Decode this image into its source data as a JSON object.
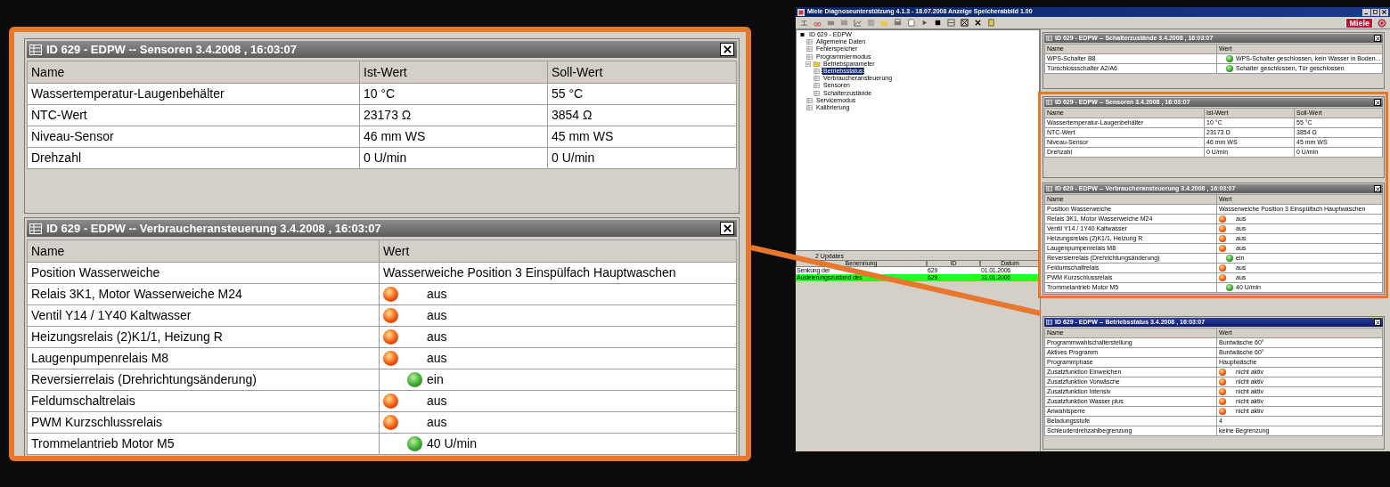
{
  "inset": {
    "panels": [
      {
        "title": "ID 629 - EDPW -- Sensoren 3.4.2008 , 16:03:07",
        "active": false,
        "columns": [
          "Name",
          "Ist-Wert",
          "Soll-Wert"
        ],
        "rows": [
          {
            "kind": "text",
            "cells": [
              "Wassertemperatur-Laugenbehälter",
              "10 °C",
              "55 °C"
            ]
          },
          {
            "kind": "text",
            "cells": [
              "NTC-Wert",
              "23173 Ω",
              "3854 Ω"
            ]
          },
          {
            "kind": "text",
            "cells": [
              "Niveau-Sensor",
              "46 mm WS",
              "45 mm WS"
            ]
          },
          {
            "kind": "text",
            "cells": [
              "Drehzahl",
              "0 U/min",
              "0 U/min"
            ]
          }
        ]
      },
      {
        "title": "ID 629 - EDPW -- Verbraucheransteuerung 3.4.2008 , 16:03:07",
        "active": false,
        "columns": [
          "Name",
          "Wert"
        ],
        "rows": [
          {
            "kind": "text",
            "cells": [
              "Position Wasserweiche",
              "Wasserweiche Position 3 Einspülfach Hauptwaschen"
            ]
          },
          {
            "kind": "lamp",
            "on": false,
            "cells": [
              "Relais 3K1, Motor Wasserweiche M24",
              "aus"
            ]
          },
          {
            "kind": "lamp",
            "on": false,
            "cells": [
              "Ventil Y14 / 1Y40 Kaltwasser",
              "aus"
            ]
          },
          {
            "kind": "lamp",
            "on": false,
            "cells": [
              "Heizungsrelais (2)K1/1, Heizung R",
              "aus"
            ]
          },
          {
            "kind": "lamp",
            "on": false,
            "cells": [
              "Laugenpumpenrelais M8",
              "aus"
            ]
          },
          {
            "kind": "lamp",
            "on": true,
            "cells": [
              "Reversierrelais (Drehrichtungsänderung)",
              "ein"
            ]
          },
          {
            "kind": "lamp",
            "on": false,
            "cells": [
              "Feldumschaltrelais",
              "aus"
            ]
          },
          {
            "kind": "lamp",
            "on": false,
            "cells": [
              "PWM Kurzschlussrelais",
              "aus"
            ]
          },
          {
            "kind": "lamp",
            "on": true,
            "cells": [
              "Trommelantrieb Motor M5",
              "40 U/min"
            ]
          }
        ]
      }
    ]
  },
  "window": {
    "title": "Miele Diagnoseunterstützung 4.1.3 - 18.07.2008 Anzeige Speicherabbild 1.00",
    "logo": "Miele"
  },
  "tree": {
    "label": "ID 629 - EDPW",
    "selected": false,
    "children": [
      {
        "label": "Allgemeine Daten",
        "selected": false
      },
      {
        "label": "Fehlerspeicher",
        "selected": false
      },
      {
        "label": "Programmiermodus",
        "selected": false
      },
      {
        "label": "Betriebsparameter",
        "selected": false,
        "expanded": true,
        "children": [
          {
            "label": "Betriebsstatus",
            "selected": true
          },
          {
            "label": "Verbraucheransteuerung",
            "selected": false
          },
          {
            "label": "Sensoren",
            "selected": false
          },
          {
            "label": "Schalterzustände",
            "selected": false
          }
        ]
      },
      {
        "label": "Servicemodus",
        "selected": false
      },
      {
        "label": "Kalibrierung",
        "selected": false
      }
    ]
  },
  "updates": {
    "caption": "2 Updates",
    "columns": [
      "Benennung",
      "ID",
      "Datum"
    ],
    "rows": [
      {
        "selected": false,
        "cells": [
          "Senkung der",
          "629",
          "01.01.2006"
        ]
      },
      {
        "selected": true,
        "cells": [
          "Ausleierungszustand des",
          "629",
          "31.01.2006"
        ]
      }
    ]
  },
  "panels": [
    {
      "title": "ID 629 - EDPW -- Schalterzustände 3.4.2008 , 16:03:07",
      "active": false,
      "columns": [
        "Name",
        "Wert"
      ],
      "rows": [
        {
          "kind": "lamp",
          "on": true,
          "cells": [
            "WPS-Schalter B8",
            "WPS-Schalter geschlossen, kein Wasser in Boden..."
          ]
        },
        {
          "kind": "lamp",
          "on": true,
          "cells": [
            "Türschlossschalter A2/A6",
            "Schalter geschlossen, Tür geschlossen"
          ]
        }
      ]
    },
    {
      "title": "ID 629 - EDPW -- Sensoren 3.4.2008 , 16:03:07",
      "active": false,
      "columns": [
        "Name",
        "Ist-Wert",
        "Soll-Wert"
      ],
      "rows": [
        {
          "kind": "text",
          "cells": [
            "Wassertemperatur-Laugenbehälter",
            "10 °C",
            "55 °C"
          ]
        },
        {
          "kind": "text",
          "cells": [
            "NTC-Wert",
            "23173 Ω",
            "3854 Ω"
          ]
        },
        {
          "kind": "text",
          "cells": [
            "Niveau-Sensor",
            "46 mm WS",
            "45 mm WS"
          ]
        },
        {
          "kind": "text",
          "cells": [
            "Drehzahl",
            "0 U/min",
            "0 U/min"
          ]
        }
      ]
    },
    {
      "title": "ID 629 - EDPW -- Verbraucheransteuerung 3.4.2008 , 16:03:07",
      "active": false,
      "columns": [
        "Name",
        "Wert"
      ],
      "rows": [
        {
          "kind": "text",
          "cells": [
            "Position Wasserweiche",
            "Wasserweiche Position 3 Einspülfach Hauptwaschen"
          ]
        },
        {
          "kind": "lamp",
          "on": false,
          "cells": [
            "Relais 3K1, Motor Wasserweiche M24",
            "aus"
          ]
        },
        {
          "kind": "lamp",
          "on": false,
          "cells": [
            "Ventil Y14 / 1Y40 Kaltwasser",
            "aus"
          ]
        },
        {
          "kind": "lamp",
          "on": false,
          "cells": [
            "Heizungsrelais (2)K1/1, Heizung R",
            "aus"
          ]
        },
        {
          "kind": "lamp",
          "on": false,
          "cells": [
            "Laugenpumpenrelais M8",
            "aus"
          ]
        },
        {
          "kind": "lamp",
          "on": true,
          "cells": [
            "Reversierrelais (Drehrichtungsänderung)",
            "ein"
          ]
        },
        {
          "kind": "lamp",
          "on": false,
          "cells": [
            "Feldumschaltrelais",
            "aus"
          ]
        },
        {
          "kind": "lamp",
          "on": false,
          "cells": [
            "PWM Kurzschlussrelais",
            "aus"
          ]
        },
        {
          "kind": "lamp",
          "on": true,
          "cells": [
            "Trommelantrieb Motor M5",
            "40 U/min"
          ]
        }
      ]
    },
    {
      "title": "ID 629 - EDPW -- Betriebsstatus 3.4.2008 , 16:03:07",
      "active": true,
      "columns": [
        "Name",
        "Wert"
      ],
      "rows": [
        {
          "kind": "text",
          "cells": [
            "Programmwahlschalterstellung",
            "Buntwäsche 60°"
          ]
        },
        {
          "kind": "text",
          "cells": [
            "Aktives Programm",
            "Buntwäsche 60°"
          ]
        },
        {
          "kind": "text",
          "cells": [
            "Programmphase",
            "Hauptwäsche"
          ]
        },
        {
          "kind": "lamp",
          "on": false,
          "cells": [
            "Zusatzfunktion Einweichen",
            "nicht aktiv"
          ]
        },
        {
          "kind": "lamp",
          "on": false,
          "cells": [
            "Zusatzfunktion Vorwäsche",
            "nicht aktiv"
          ]
        },
        {
          "kind": "lamp",
          "on": false,
          "cells": [
            "Zusatzfunktion Intensiv",
            "nicht aktiv"
          ]
        },
        {
          "kind": "lamp",
          "on": false,
          "cells": [
            "Zusatzfunktion Wasser plus",
            "nicht aktiv"
          ]
        },
        {
          "kind": "lamp",
          "on": false,
          "cells": [
            "Anwahlsperre",
            "nicht aktiv"
          ]
        },
        {
          "kind": "text",
          "cells": [
            "Beladungsstufe",
            "4"
          ]
        },
        {
          "kind": "text",
          "cells": [
            "Schleuderdrehzahlbegrenzung",
            "keine Begrenzung"
          ]
        }
      ]
    }
  ]
}
